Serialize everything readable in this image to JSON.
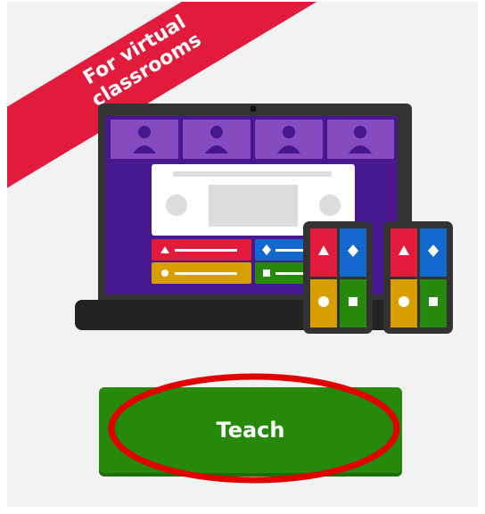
{
  "ribbon": {
    "text": "For virtual classrooms",
    "color": "#e21b3c"
  },
  "illustration": {
    "participants": 4,
    "answer_colors": [
      "#e21b3c",
      "#1368ce",
      "#d89e00",
      "#26890c"
    ],
    "answer_icons": [
      "triangle-icon",
      "diamond-icon",
      "circle-icon",
      "square-icon"
    ]
  },
  "teach": {
    "label": "Teach",
    "color": "#26890c"
  },
  "annotation": {
    "color": "#e00000"
  }
}
